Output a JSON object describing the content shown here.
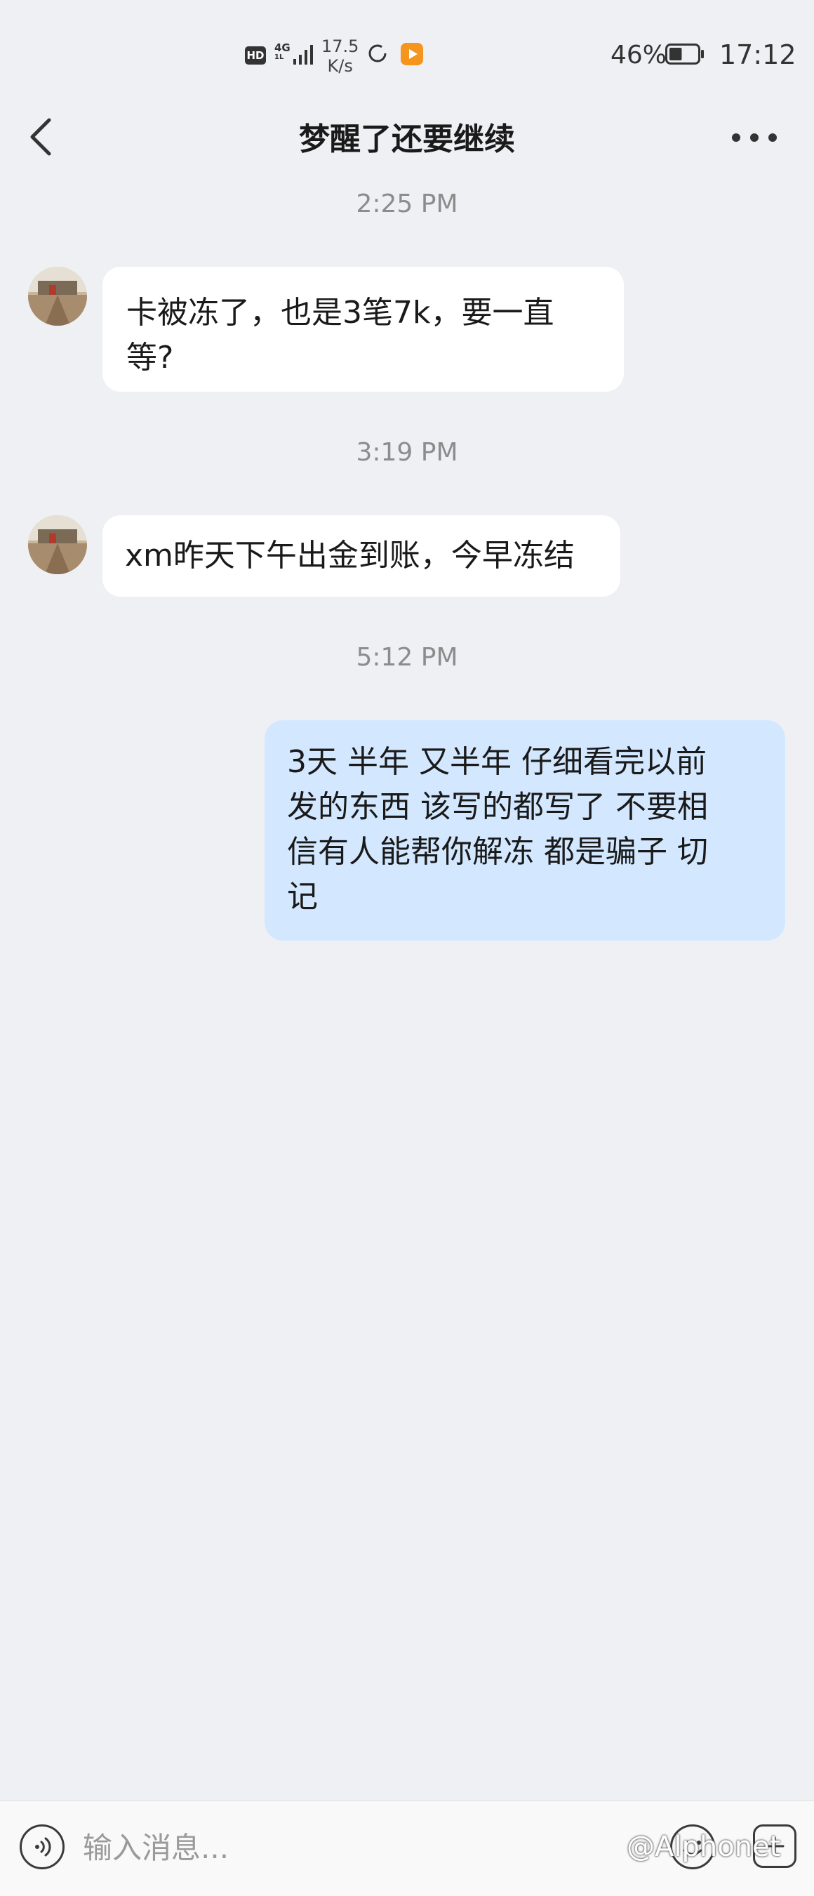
{
  "status_bar": {
    "hd_badge": "HD",
    "network_top": "4G",
    "network_bottom": "1L",
    "speed_value": "17.5",
    "speed_unit": "K/s",
    "battery_percent": "46%",
    "battery_level": 0.46,
    "time": "17:12"
  },
  "header": {
    "title": "梦醒了还要继续"
  },
  "messages": [
    {
      "type": "timestamp",
      "text": "2:25 PM"
    },
    {
      "type": "incoming",
      "lines": [
        "卡被冻了，也是3笔7k，要一直",
        "等?"
      ]
    },
    {
      "type": "timestamp",
      "text": "3:19 PM"
    },
    {
      "type": "incoming",
      "lines": [
        "xm昨天下午出金到账，今早冻结"
      ]
    },
    {
      "type": "timestamp",
      "text": "5:12 PM"
    },
    {
      "type": "outgoing",
      "lines": [
        "3天 半年  又半年 仔细看完以前",
        "发的东西 该写的都写了 不要相",
        "信有人能帮你解冻 都是骗子 切",
        "记"
      ]
    }
  ],
  "input": {
    "placeholder": "输入消息..."
  },
  "watermark": "@Alphonet",
  "colors": {
    "background": "#eff0f3",
    "incoming_bubble": "#ffffff",
    "outgoing_bubble": "#d3e8ff"
  }
}
